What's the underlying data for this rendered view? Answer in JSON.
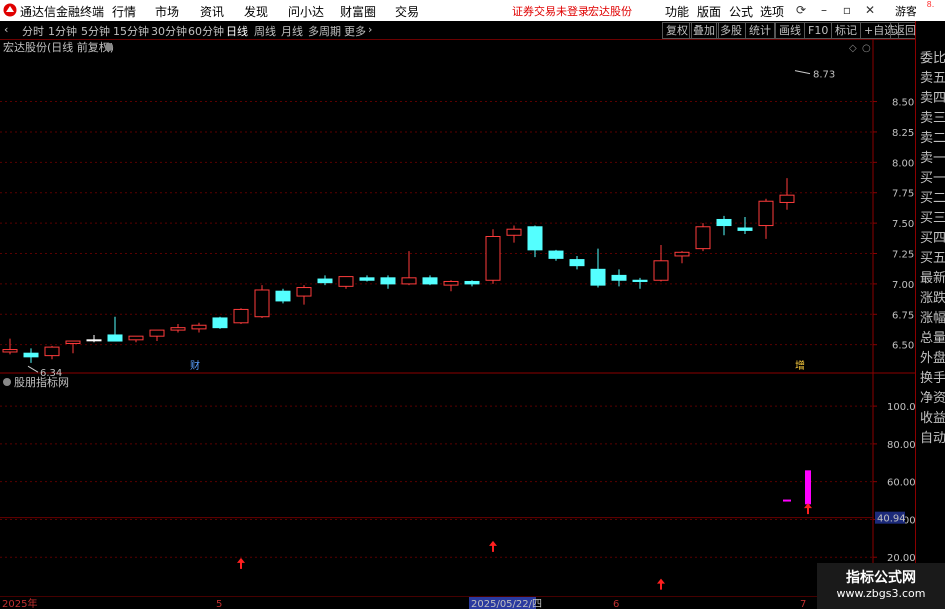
{
  "app": {
    "title": "通达信金融终端"
  },
  "menu": {
    "items": [
      "行情",
      "市场",
      "资讯",
      "发现",
      "问小达",
      "财富圈",
      "交易"
    ],
    "notice": "证券交易未登录",
    "stock_name": "宏达股份",
    "right_items": [
      "功能",
      "版面",
      "公式",
      "选项"
    ],
    "guest": "游客"
  },
  "toolbar": {
    "periods": [
      "分时",
      "1分钟",
      "5分钟",
      "15分钟",
      "30分钟",
      "60分钟",
      "日线",
      "周线",
      "月线",
      "多周期",
      "更多"
    ],
    "active_period": "日线",
    "right_buttons": [
      "复权",
      "叠加",
      "多股",
      "统计",
      "画线",
      "F10",
      "标记",
      "+自选",
      "返回"
    ]
  },
  "right_panel": {
    "top": "8.",
    "items": [
      "委比",
      "卖五",
      "卖四",
      "卖三",
      "卖二",
      "卖一",
      "买一",
      "买二",
      "买三",
      "买四",
      "买五",
      "最新",
      "涨跌",
      "涨幅",
      "总量",
      "外盘",
      "换手",
      "净资",
      "收益",
      "自动"
    ]
  },
  "chart_data": [
    {
      "type": "candlestick",
      "title": "宏达股份(日线 前复权)",
      "y_ticks": [
        6.5,
        6.75,
        7.0,
        7.25,
        7.5,
        7.75,
        8.0,
        8.25,
        8.5
      ],
      "ylim": [
        6.3,
        8.85
      ],
      "high_marker": "8.73",
      "low_marker": "6.34",
      "event_markers": [
        "财",
        "增"
      ],
      "candles": [
        {
          "o": 6.44,
          "h": 6.55,
          "l": 6.42,
          "c": 6.46
        },
        {
          "o": 6.43,
          "h": 6.47,
          "l": 6.35,
          "c": 6.4
        },
        {
          "o": 6.41,
          "h": 6.49,
          "l": 6.38,
          "c": 6.48
        },
        {
          "o": 6.51,
          "h": 6.53,
          "l": 6.43,
          "c": 6.53
        },
        {
          "o": 6.54,
          "h": 6.58,
          "l": 6.52,
          "c": 6.54
        },
        {
          "o": 6.58,
          "h": 6.73,
          "l": 6.56,
          "c": 6.53
        },
        {
          "o": 6.54,
          "h": 6.57,
          "l": 6.52,
          "c": 6.57
        },
        {
          "o": 6.57,
          "h": 6.62,
          "l": 6.53,
          "c": 6.62
        },
        {
          "o": 6.62,
          "h": 6.67,
          "l": 6.6,
          "c": 6.64
        },
        {
          "o": 6.63,
          "h": 6.68,
          "l": 6.6,
          "c": 6.66
        },
        {
          "o": 6.72,
          "h": 6.73,
          "l": 6.63,
          "c": 6.64
        },
        {
          "o": 6.68,
          "h": 6.8,
          "l": 6.67,
          "c": 6.79
        },
        {
          "o": 6.73,
          "h": 6.99,
          "l": 6.72,
          "c": 6.95
        },
        {
          "o": 6.94,
          "h": 6.96,
          "l": 6.84,
          "c": 6.86
        },
        {
          "o": 6.9,
          "h": 6.99,
          "l": 6.83,
          "c": 6.97
        },
        {
          "o": 7.04,
          "h": 7.07,
          "l": 6.99,
          "c": 7.01
        },
        {
          "o": 6.98,
          "h": 7.06,
          "l": 6.96,
          "c": 7.06
        },
        {
          "o": 7.05,
          "h": 7.07,
          "l": 7.02,
          "c": 7.03
        },
        {
          "o": 7.05,
          "h": 7.07,
          "l": 6.96,
          "c": 7.0
        },
        {
          "o": 7.0,
          "h": 7.27,
          "l": 6.99,
          "c": 7.05
        },
        {
          "o": 7.05,
          "h": 7.07,
          "l": 6.99,
          "c": 7.0
        },
        {
          "o": 6.99,
          "h": 7.03,
          "l": 6.94,
          "c": 7.02
        },
        {
          "o": 7.02,
          "h": 7.03,
          "l": 6.98,
          "c": 7.0
        },
        {
          "o": 7.03,
          "h": 7.45,
          "l": 7.0,
          "c": 7.39
        },
        {
          "o": 7.4,
          "h": 7.48,
          "l": 7.34,
          "c": 7.45
        },
        {
          "o": 7.47,
          "h": 7.48,
          "l": 7.22,
          "c": 7.28
        },
        {
          "o": 7.27,
          "h": 7.28,
          "l": 7.19,
          "c": 7.21
        },
        {
          "o": 7.2,
          "h": 7.23,
          "l": 7.12,
          "c": 7.15
        },
        {
          "o": 7.12,
          "h": 7.29,
          "l": 6.97,
          "c": 6.99
        },
        {
          "o": 7.07,
          "h": 7.12,
          "l": 6.98,
          "c": 7.03
        },
        {
          "o": 7.03,
          "h": 7.05,
          "l": 6.96,
          "c": 7.02
        },
        {
          "o": 7.03,
          "h": 7.32,
          "l": 7.02,
          "c": 7.19
        },
        {
          "o": 7.23,
          "h": 7.27,
          "l": 7.17,
          "c": 7.26
        },
        {
          "o": 7.29,
          "h": 7.5,
          "l": 7.27,
          "c": 7.47
        },
        {
          "o": 7.53,
          "h": 7.56,
          "l": 7.4,
          "c": 7.48
        },
        {
          "o": 7.46,
          "h": 7.55,
          "l": 7.41,
          "c": 7.44
        },
        {
          "o": 7.48,
          "h": 7.7,
          "l": 7.37,
          "c": 7.68
        },
        {
          "o": 7.67,
          "h": 7.87,
          "l": 7.61,
          "c": 7.73
        }
      ]
    },
    {
      "type": "indicator",
      "title": "股朋指标网",
      "y_ticks": [
        20.0,
        40.0,
        60.0,
        80.0,
        100.0
      ],
      "ylim": [
        0,
        108
      ],
      "current_value": "40.94",
      "threshold": 40.94,
      "signal_arrows": [
        11,
        23,
        31,
        38
      ],
      "bars": [
        {
          "index": 38,
          "from": 48,
          "to": 66
        }
      ],
      "dashes": [
        {
          "index": 37,
          "value": 50
        }
      ]
    }
  ],
  "date_axis": {
    "labels": [
      "2025年",
      "5",
      "2025/05/22/四",
      "6",
      "7"
    ]
  },
  "watermark": {
    "line1": "指标公式网",
    "line2": "www.zbgs3.com"
  }
}
